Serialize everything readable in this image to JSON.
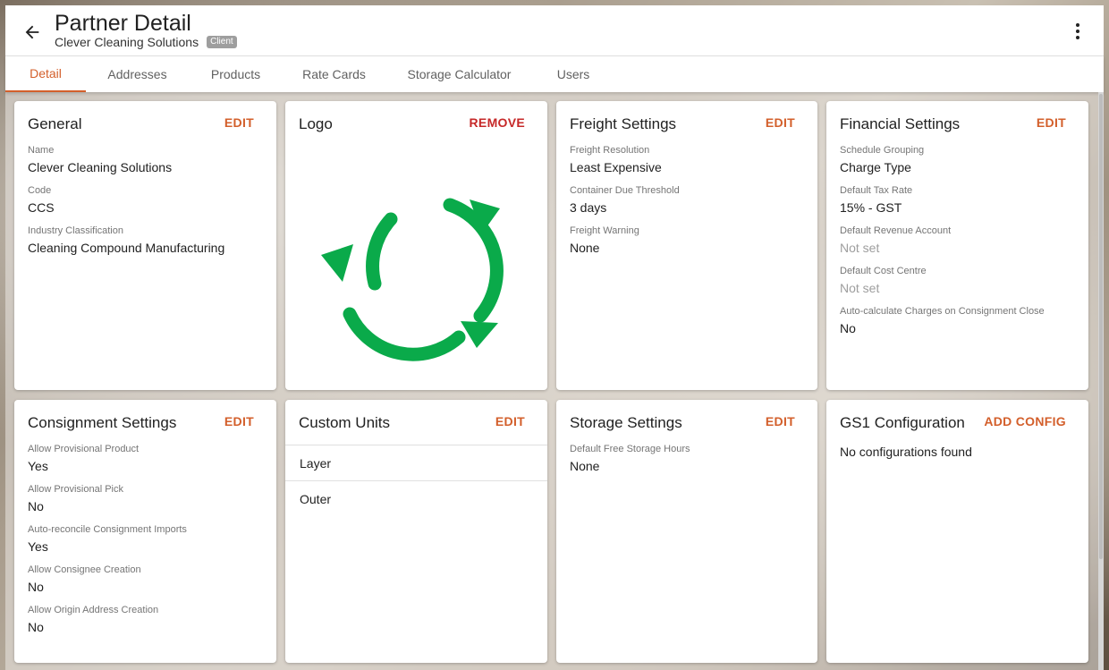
{
  "header": {
    "title": "Partner Detail",
    "partner_name": "Clever Cleaning Solutions",
    "badge": "Client"
  },
  "tabs": [
    {
      "label": "Detail",
      "active": true
    },
    {
      "label": "Addresses"
    },
    {
      "label": "Products"
    },
    {
      "label": "Rate Cards"
    },
    {
      "label": "Storage Calculator"
    },
    {
      "label": "Users"
    }
  ],
  "general": {
    "title": "General",
    "action": "EDIT",
    "fields": [
      {
        "label": "Name",
        "value": "Clever Cleaning Solutions"
      },
      {
        "label": "Code",
        "value": "CCS"
      },
      {
        "label": "Industry Classification",
        "value": "Cleaning Compound Manufacturing"
      }
    ]
  },
  "logo": {
    "title": "Logo",
    "action": "REMOVE",
    "image": "recycle-arrows-icon",
    "color": "#0aaa4a"
  },
  "freight": {
    "title": "Freight Settings",
    "action": "EDIT",
    "fields": [
      {
        "label": "Freight Resolution",
        "value": "Least Expensive"
      },
      {
        "label": "Container Due Threshold",
        "value": "3 days"
      },
      {
        "label": "Freight Warning",
        "value": "None"
      }
    ]
  },
  "financial": {
    "title": "Financial Settings",
    "action": "EDIT",
    "fields": [
      {
        "label": "Schedule Grouping",
        "value": "Charge Type"
      },
      {
        "label": "Default Tax Rate",
        "value": "15% - GST"
      },
      {
        "label": "Default Revenue Account",
        "value": "Not set"
      },
      {
        "label": "Default Cost Centre",
        "value": "Not set"
      },
      {
        "label": "Auto-calculate Charges on Consignment Close",
        "value": "No"
      }
    ]
  },
  "consignment": {
    "title": "Consignment Settings",
    "action": "EDIT",
    "fields": [
      {
        "label": "Allow Provisional Product",
        "value": "Yes"
      },
      {
        "label": "Allow Provisional Pick",
        "value": "No"
      },
      {
        "label": "Auto-reconcile Consignment Imports",
        "value": "Yes"
      },
      {
        "label": "Allow Consignee Creation",
        "value": "No"
      },
      {
        "label": "Allow Origin Address Creation",
        "value": "No"
      }
    ]
  },
  "custom_units": {
    "title": "Custom Units",
    "action": "EDIT",
    "items": [
      "Layer",
      "Outer"
    ]
  },
  "storage": {
    "title": "Storage Settings",
    "action": "EDIT",
    "fields": [
      {
        "label": "Default Free Storage Hours",
        "value": "None"
      }
    ]
  },
  "gs1": {
    "title": "GS1 Configuration",
    "action": "ADD CONFIG",
    "empty_text": "No configurations found"
  },
  "colors": {
    "accent": "#d35f2b",
    "danger": "#c62828"
  }
}
